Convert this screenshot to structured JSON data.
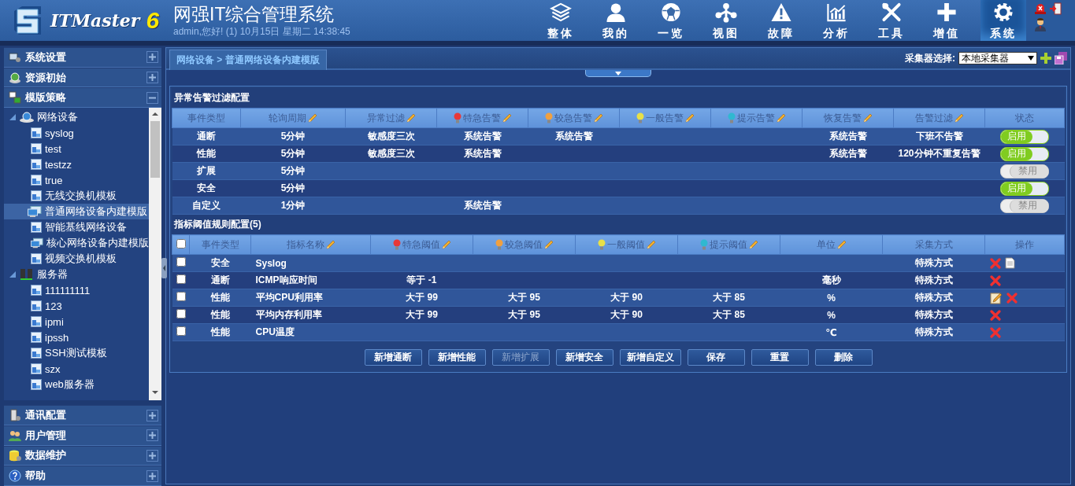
{
  "header": {
    "logo_text": "ITMaster",
    "logo_version": "6",
    "title": "网强IT综合管理系统",
    "user_info": "admin,您好! (1) 10月15日 星期二 14:38:45"
  },
  "nav": [
    {
      "label": "整体",
      "selected": false
    },
    {
      "label": "我的",
      "selected": false
    },
    {
      "label": "一览",
      "selected": false
    },
    {
      "label": "视图",
      "selected": false
    },
    {
      "label": "故障",
      "selected": false
    },
    {
      "label": "分析",
      "selected": false
    },
    {
      "label": "工具",
      "selected": false
    },
    {
      "label": "增值",
      "selected": false
    },
    {
      "label": "系统",
      "selected": true
    }
  ],
  "sidebar": [
    {
      "label": "系统设置",
      "expanded": false
    },
    {
      "label": "资源初始",
      "expanded": false
    },
    {
      "label": "模版策略",
      "expanded": true,
      "tree": [
        {
          "label": "网络设备",
          "expanded": true,
          "children": [
            {
              "label": "syslog",
              "kind": "template",
              "selected": false
            },
            {
              "label": "test",
              "kind": "template",
              "selected": false
            },
            {
              "label": "testzz",
              "kind": "template",
              "selected": false
            },
            {
              "label": "true",
              "kind": "template",
              "selected": false
            },
            {
              "label": "无线交换机模板",
              "kind": "template",
              "selected": false
            },
            {
              "label": "普通网络设备内建模版",
              "kind": "builtin",
              "selected": true
            },
            {
              "label": "智能基线网络设备",
              "kind": "template",
              "selected": false
            },
            {
              "label": "核心网络设备内建模版",
              "kind": "builtin",
              "selected": false
            },
            {
              "label": "视频交换机模板",
              "kind": "template",
              "selected": false
            }
          ]
        },
        {
          "label": "服务器",
          "expanded": true,
          "children": [
            {
              "label": "111111111",
              "kind": "template",
              "selected": false
            },
            {
              "label": "123",
              "kind": "template",
              "selected": false
            },
            {
              "label": "ipmi",
              "kind": "template",
              "selected": false
            },
            {
              "label": "ipssh",
              "kind": "template",
              "selected": false
            },
            {
              "label": "SSH测试模板",
              "kind": "template",
              "selected": false
            },
            {
              "label": "szx",
              "kind": "template",
              "selected": false
            },
            {
              "label": "web服务器",
              "kind": "template",
              "selected": false
            }
          ]
        }
      ]
    },
    {
      "label": "通讯配置",
      "expanded": false
    },
    {
      "label": "用户管理",
      "expanded": false
    },
    {
      "label": "数据维护",
      "expanded": false
    },
    {
      "label": "帮助",
      "expanded": false
    }
  ],
  "breadcrumb": "网络设备 > 普通网络设备内建模版",
  "collector": {
    "label": "采集器选择:",
    "value": "本地采集器"
  },
  "alarm_filter": {
    "title": "异常告警过滤配置",
    "columns": [
      {
        "label": "事件类型",
        "editable": false
      },
      {
        "label": "轮询周期",
        "editable": true
      },
      {
        "label": "异常过滤",
        "editable": true
      },
      {
        "label": "特急告警",
        "editable": true,
        "color": "#e83838"
      },
      {
        "label": "较急告警",
        "editable": true,
        "color": "#f0a040"
      },
      {
        "label": "一般告警",
        "editable": true,
        "color": "#e8e048"
      },
      {
        "label": "提示告警",
        "editable": true,
        "color": "#30b8d0"
      },
      {
        "label": "恢复告警",
        "editable": true
      },
      {
        "label": "告警过滤",
        "editable": true
      },
      {
        "label": "状态",
        "editable": false
      }
    ],
    "rows": [
      {
        "event": "通断",
        "poll": "5分钟",
        "filter": "敏感度三次",
        "critical": "系统告警",
        "major": "系统告警",
        "recovery": "系统告警",
        "alarm_filter": "下班不告警",
        "status": {
          "label": "启用",
          "on": true
        }
      },
      {
        "event": "性能",
        "poll": "5分钟",
        "filter": "敏感度三次",
        "critical": "系统告警",
        "recovery": "系统告警",
        "alarm_filter": "120分钟不重复告警",
        "status": {
          "label": "启用",
          "on": true
        }
      },
      {
        "event": "扩展",
        "poll": "5分钟",
        "status": {
          "label": "禁用",
          "on": false
        }
      },
      {
        "event": "安全",
        "poll": "5分钟",
        "status": {
          "label": "启用",
          "on": true
        }
      },
      {
        "event": "自定义",
        "poll": "1分钟",
        "critical": "系统告警",
        "status": {
          "label": "禁用",
          "on": false
        }
      }
    ]
  },
  "thresholds": {
    "title": "指标阈值规则配置(5)",
    "select_all": {
      "checked": false
    },
    "columns": [
      {
        "label": "事件类型",
        "editable": false
      },
      {
        "label": "指标名称",
        "editable": true
      },
      {
        "label": "特急阈值",
        "editable": true,
        "color": "#e83838"
      },
      {
        "label": "较急阈值",
        "editable": true,
        "color": "#f0a040"
      },
      {
        "label": "一般阈值",
        "editable": true,
        "color": "#e8e048"
      },
      {
        "label": "提示阈值",
        "editable": true,
        "color": "#30b8d0"
      },
      {
        "label": "单位",
        "editable": true
      },
      {
        "label": "采集方式",
        "editable": false
      },
      {
        "label": "操作",
        "editable": false
      }
    ],
    "rows": [
      {
        "checked": false,
        "event": "安全",
        "metric": "Syslog",
        "method": "特殊方式",
        "actions": [
          {
            "kind": "delete"
          },
          {
            "kind": "note"
          }
        ]
      },
      {
        "checked": false,
        "event": "通断",
        "metric": "ICMP响应时间",
        "critical": "等于 -1",
        "unit": "毫秒",
        "method": "特殊方式",
        "actions": [
          {
            "kind": "delete"
          }
        ]
      },
      {
        "checked": false,
        "event": "性能",
        "metric": "平均CPU利用率",
        "critical": "大于 99",
        "major": "大于 95",
        "minor": "大于 90",
        "hint": "大于 85",
        "unit": "%",
        "method": "特殊方式",
        "actions": [
          {
            "kind": "edit"
          },
          {
            "kind": "delete"
          }
        ]
      },
      {
        "checked": false,
        "event": "性能",
        "metric": "平均内存利用率",
        "critical": "大于 99",
        "major": "大于 95",
        "minor": "大于 90",
        "hint": "大于 85",
        "unit": "%",
        "method": "特殊方式",
        "actions": [
          {
            "kind": "delete"
          }
        ]
      },
      {
        "checked": false,
        "event": "性能",
        "metric": "CPU温度",
        "unit": "℃",
        "method": "特殊方式",
        "actions": [
          {
            "kind": "delete"
          }
        ]
      }
    ]
  },
  "buttons": [
    {
      "label": "新增通断",
      "disabled": false
    },
    {
      "label": "新增性能",
      "disabled": false
    },
    {
      "label": "新增扩展",
      "disabled": true
    },
    {
      "label": "新增安全",
      "disabled": false
    },
    {
      "label": "新增自定义",
      "disabled": false
    },
    {
      "label": "保存",
      "disabled": false
    },
    {
      "label": "重置",
      "disabled": false
    },
    {
      "label": "删除",
      "disabled": false
    }
  ]
}
